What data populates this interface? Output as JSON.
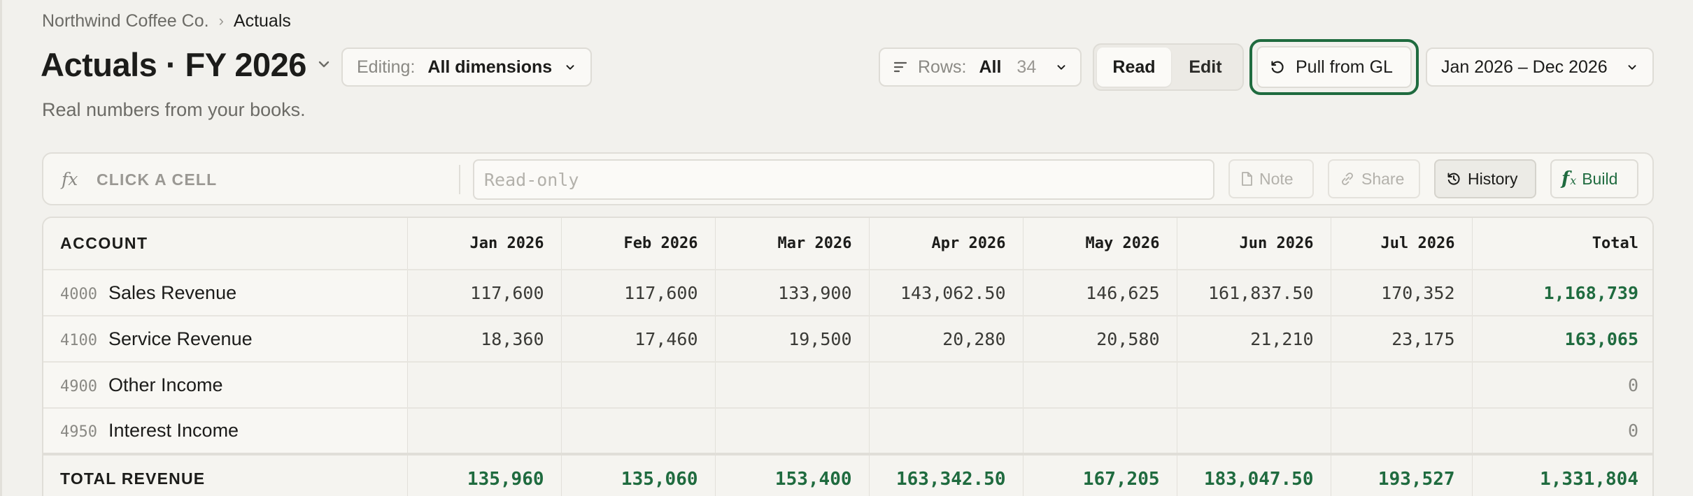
{
  "breadcrumb": {
    "parent": "Northwind Coffee Co.",
    "separator": "›",
    "current": "Actuals"
  },
  "header": {
    "title": "Actuals · FY 2026",
    "subtitle": "Real numbers from your books."
  },
  "editing": {
    "label": "Editing:",
    "value": "All dimensions"
  },
  "rows_filter": {
    "label": "Rows:",
    "value": "All",
    "count": "34"
  },
  "mode_toggle": {
    "read": "Read",
    "edit": "Edit",
    "selected": "Read"
  },
  "pull_button": {
    "label": "Pull from GL",
    "focused": true
  },
  "date_range": {
    "label": "Jan 2026 – Dec 2026"
  },
  "formula_bar": {
    "fx_label": "fx",
    "cell_ref": "CLICK A CELL",
    "placeholder": "Read-only",
    "value": "",
    "note": "Note",
    "share": "Share",
    "history": "History",
    "build": "Build",
    "build_glyph_f": "f",
    "build_glyph_x": "x"
  },
  "table": {
    "headers": [
      "ACCOUNT",
      "Jan 2026",
      "Feb 2026",
      "Mar 2026",
      "Apr 2026",
      "May 2026",
      "Jun 2026",
      "Jul 2026",
      "Total"
    ],
    "rows": [
      {
        "code": "4000",
        "name": "Sales Revenue",
        "values": [
          "117,600",
          "117,600",
          "133,900",
          "143,062.50",
          "146,625",
          "161,837.50",
          "170,352"
        ],
        "total": "1,168,739"
      },
      {
        "code": "4100",
        "name": "Service Revenue",
        "values": [
          "18,360",
          "17,460",
          "19,500",
          "20,280",
          "20,580",
          "21,210",
          "23,175"
        ],
        "total": "163,065"
      },
      {
        "code": "4900",
        "name": "Other Income",
        "values": [
          "",
          "",
          "",
          "",
          "",
          "",
          ""
        ],
        "total": "0"
      },
      {
        "code": "4950",
        "name": "Interest Income",
        "values": [
          "",
          "",
          "",
          "",
          "",
          "",
          ""
        ],
        "total": "0"
      }
    ],
    "total_row": {
      "label": "TOTAL REVENUE",
      "values": [
        "135,960",
        "135,060",
        "153,400",
        "163,342.50",
        "167,205",
        "183,047.50",
        "193,527"
      ],
      "total": "1,331,804"
    }
  },
  "colors": {
    "accent_green": "#1f6b3f",
    "background": "#f2f1ed",
    "muted_text": "#8a8984"
  }
}
